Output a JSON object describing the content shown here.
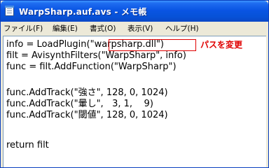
{
  "window": {
    "title": "WarpSharp.auf.avs - メモ帳"
  },
  "menu": {
    "items": [
      "ファイル(F)",
      "編集(E)",
      "書式(O)",
      "表示(V)",
      "ヘルプ(H)"
    ]
  },
  "editor": {
    "lines": [
      "info = LoadPlugin(\"warpsharp.dll\")",
      "filt = AvisynthFilters(\"WarpSharp\", info)",
      "func = filt.AddFunction(\"WarpSharp\")",
      "",
      "func.AddTrack(\"強さ\", 128, 0, 1024)",
      "func.AddTrack(\"暈し\",   3, 1,    9)",
      "func.AddTrack(\"閾値\", 128, 0, 1024)",
      "",
      "return filt"
    ],
    "annotation": "パスを変更"
  },
  "colors": {
    "titlebar": "#0a55e3",
    "annotation": "#e00000"
  }
}
